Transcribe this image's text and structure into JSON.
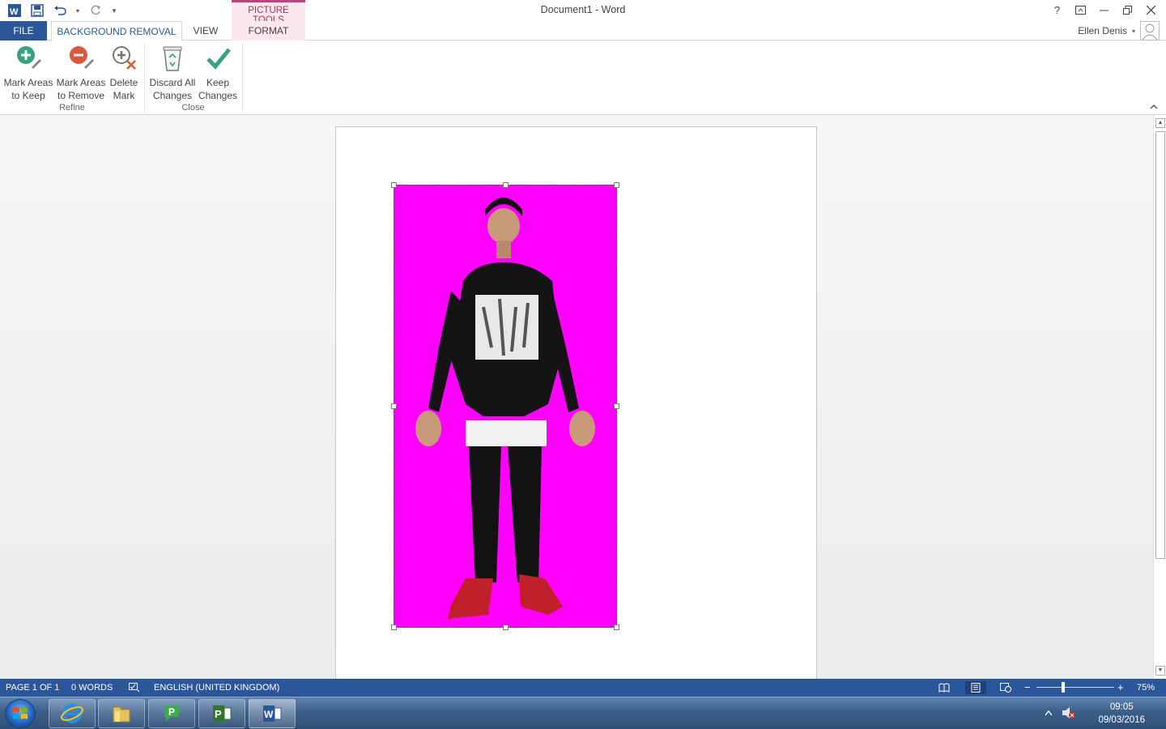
{
  "titlebar": {
    "title": "Document1 - Word",
    "contextual_group": "PICTURE TOOLS",
    "help": "?"
  },
  "tabs": {
    "file": "FILE",
    "background_removal": "BACKGROUND REMOVAL",
    "view": "VIEW",
    "format": "FORMAT"
  },
  "user": {
    "name": "Ellen Denis"
  },
  "ribbon": {
    "refine": {
      "label": "Refine",
      "mark_keep_line1": "Mark Areas",
      "mark_keep_line2": "to Keep",
      "mark_remove_line1": "Mark Areas",
      "mark_remove_line2": "to Remove",
      "delete_mark_line1": "Delete",
      "delete_mark_line2": "Mark"
    },
    "close": {
      "label": "Close",
      "discard_line1": "Discard All",
      "discard_line2": "Changes",
      "keep_line1": "Keep",
      "keep_line2": "Changes"
    }
  },
  "statusbar": {
    "page": "PAGE 1 OF 1",
    "words": "0 WORDS",
    "language": "ENGLISH (UNITED KINGDOM)",
    "zoom": "75%",
    "zoom_minus": "−",
    "zoom_plus": "+"
  },
  "taskbar": {
    "time": "09:05",
    "date": "09/03/2016"
  },
  "colors": {
    "accent": "#2b579a",
    "picture_tools": "#c0407a",
    "removal_overlay": "#ff00ff"
  }
}
